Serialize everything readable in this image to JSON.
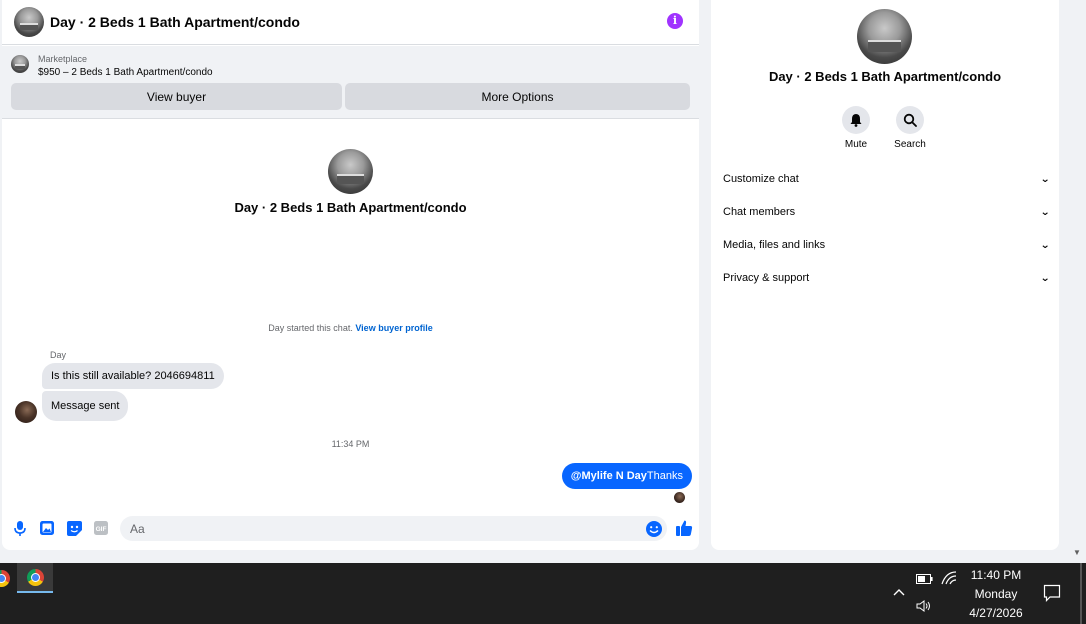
{
  "chat": {
    "title": "Day · 2 Beds 1 Bath Apartment/condo",
    "info_icon": "info-icon",
    "listing": {
      "source": "Marketplace",
      "title": "$950 – 2 Beds 1 Bath Apartment/condo",
      "view_buyer_label": "View buyer",
      "more_options_label": "More Options"
    },
    "intro_title": "Day · 2 Beds 1 Bath Apartment/condo",
    "started_text": "Day started this chat.",
    "started_link": "View buyer profile",
    "sender_name": "Day",
    "messages_in": [
      "Is this still available? 2046694811",
      "Message sent"
    ],
    "timestamp": "11:34 PM",
    "message_out": {
      "mention": "@Mylife N Day",
      "text": "Thanks"
    },
    "composer": {
      "placeholder": "Aa",
      "icons": [
        "microphone-icon",
        "image-icon",
        "sticker-icon",
        "gif-icon",
        "emoji-icon",
        "like-icon"
      ]
    }
  },
  "info_panel": {
    "title": "Day · 2 Beds 1 Bath Apartment/condo",
    "actions": [
      {
        "label": "Mute",
        "icon": "bell-icon"
      },
      {
        "label": "Search",
        "icon": "search-icon"
      }
    ],
    "sections": [
      "Customize chat",
      "Chat members",
      "Media, files and links",
      "Privacy & support"
    ]
  },
  "taskbar": {
    "time": "11:40 PM",
    "day": "Monday",
    "date": "4/27/2026"
  },
  "colors": {
    "accent": "#0866ff",
    "info_purple": "#a033ff",
    "bubble_in": "#e4e6eb",
    "background": "#f0f2f5",
    "taskbar": "#1f1f1f"
  }
}
